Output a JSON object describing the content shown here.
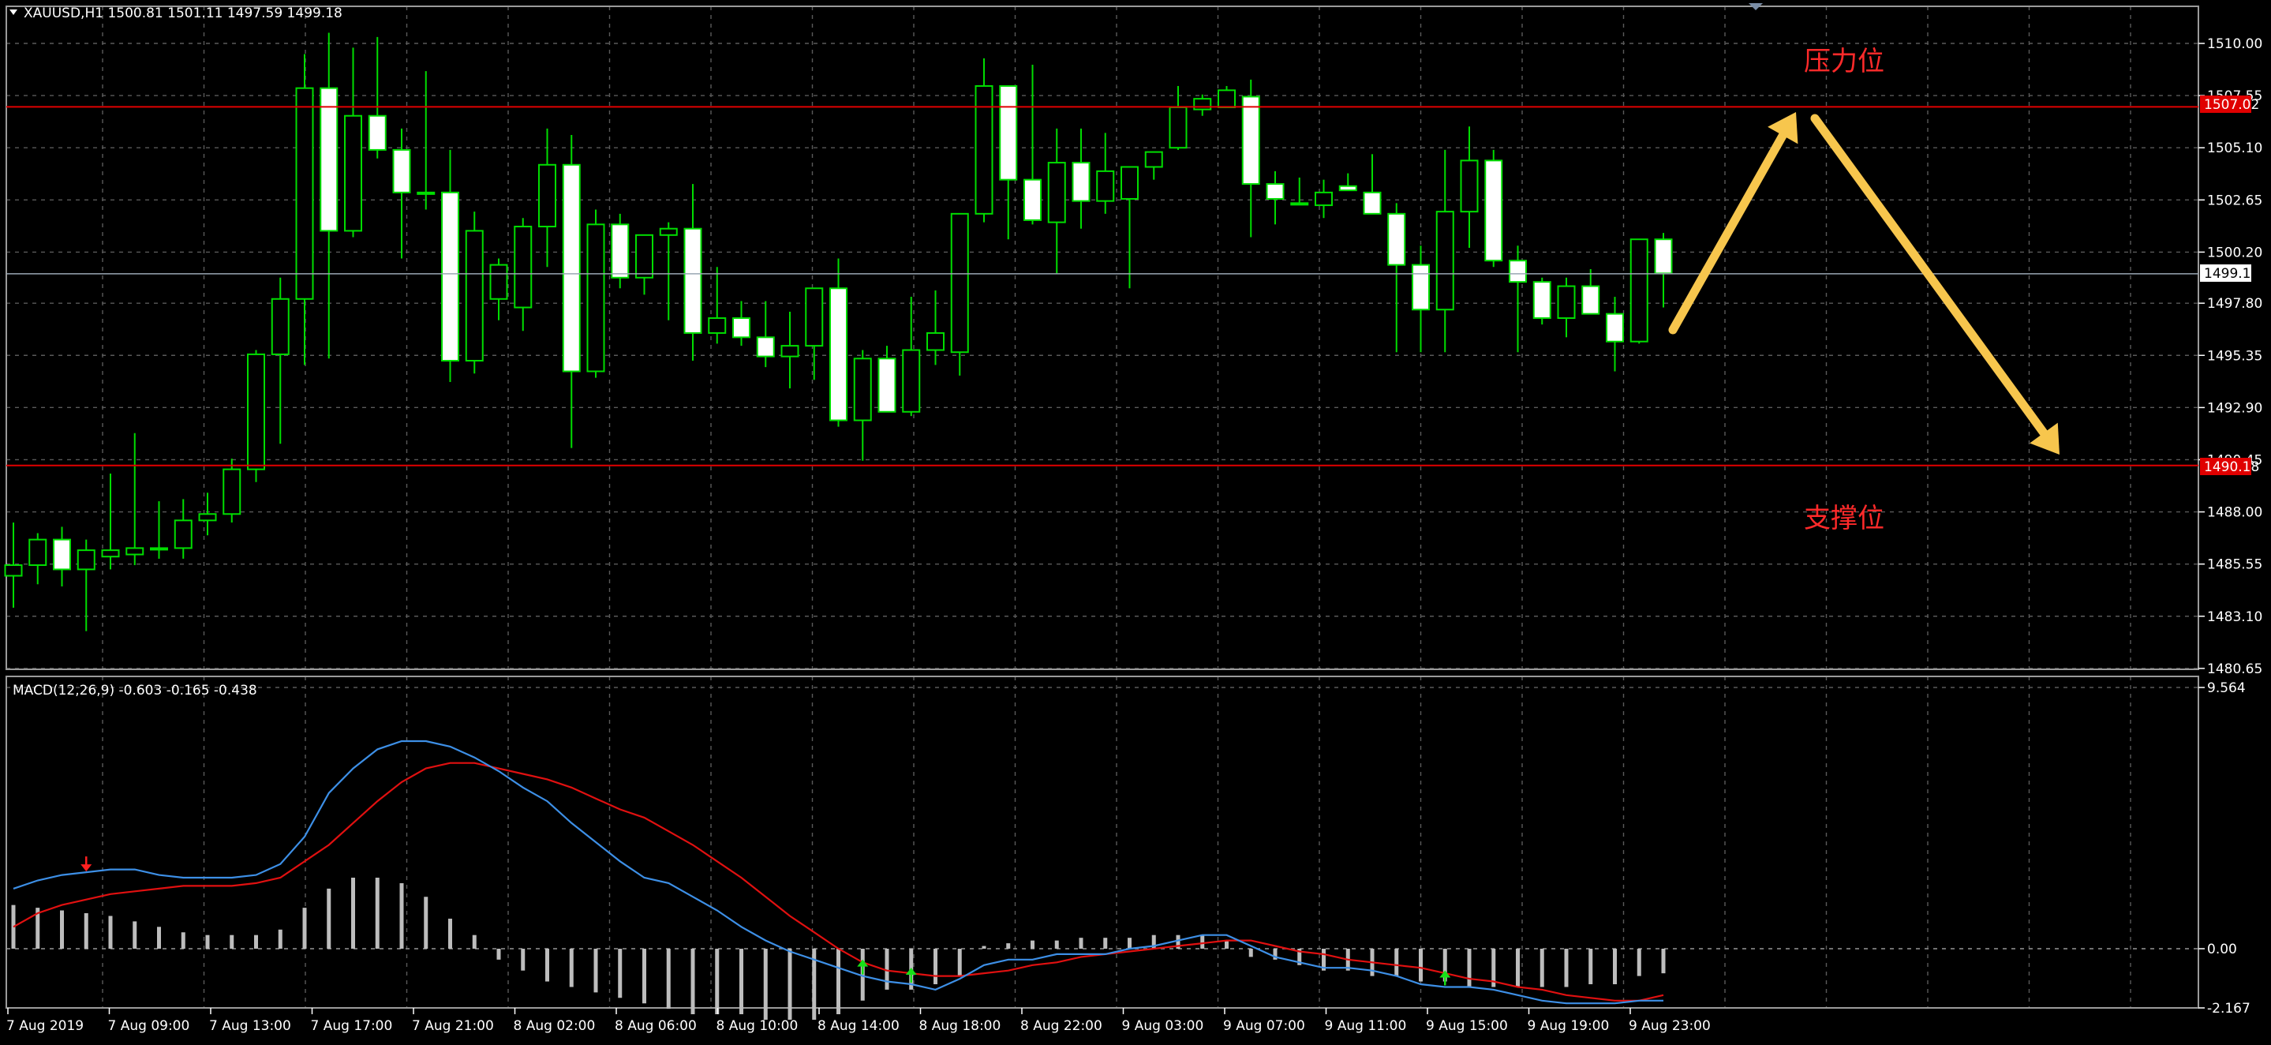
{
  "header": {
    "symbol_info": "XAUUSD,H1  1500.81 1501.11 1497.59 1499.18",
    "macd_info": "MACD(12,26,9) -0.603 -0.165 -0.438"
  },
  "annotations": {
    "resistance_label": "压力位",
    "support_label": "支撑位",
    "resistance_price": "1507.02",
    "support_price": "1490.18",
    "current_price": "1499.18"
  },
  "colors": {
    "background": "#000000",
    "grid": "#5a5a5a",
    "candle_up": "#000000",
    "candle_down": "#ffffff",
    "wick": "#00dd00",
    "level_line": "#e00000",
    "annotation_text": "#ff2a2a",
    "arrow": "#f7c64d",
    "macd_line": "#3d8fe6",
    "signal_line": "#e01010",
    "histogram": "#bdbdbd",
    "signal_arrow_up": "#18e018",
    "signal_arrow_down": "#ff2020",
    "axis_text": "#ffffff"
  },
  "chart_data": [
    {
      "type": "candlestick",
      "title": "XAUUSD,H1",
      "ylim": [
        1480.65,
        1510.9
      ],
      "y_ticks": [
        "1510.00",
        "1507.55",
        "1505.10",
        "1502.65",
        "1500.20",
        "1497.80",
        "1495.35",
        "1492.90",
        "1490.45",
        "1488.00",
        "1485.55",
        "1483.10",
        "1480.65"
      ],
      "x_tick_labels": [
        "7 Aug 2019",
        "7 Aug 09:00",
        "7 Aug 13:00",
        "7 Aug 17:00",
        "7 Aug 21:00",
        "8 Aug 02:00",
        "8 Aug 06:00",
        "8 Aug 10:00",
        "8 Aug 14:00",
        "8 Aug 18:00",
        "8 Aug 22:00",
        "9 Aug 03:00",
        "9 Aug 07:00",
        "9 Aug 11:00",
        "9 Aug 15:00",
        "9 Aug 19:00",
        "9 Aug 23:00"
      ],
      "horizontal_levels": [
        1507.02,
        1490.18
      ],
      "current_price": 1499.18,
      "ohlc": [
        [
          1485.0,
          1487.5,
          1483.5,
          1485.5
        ],
        [
          1485.5,
          1487.0,
          1484.6,
          1486.7
        ],
        [
          1486.7,
          1487.3,
          1484.5,
          1485.3
        ],
        [
          1485.3,
          1486.7,
          1482.4,
          1486.2
        ],
        [
          1485.9,
          1489.8,
          1485.3,
          1486.2
        ],
        [
          1486.0,
          1491.7,
          1485.5,
          1486.3
        ],
        [
          1486.3,
          1488.5,
          1485.8,
          1486.3
        ],
        [
          1486.3,
          1488.6,
          1485.8,
          1487.6
        ],
        [
          1487.6,
          1488.9,
          1486.9,
          1487.9
        ],
        [
          1487.9,
          1490.5,
          1487.5,
          1490.0
        ],
        [
          1490.0,
          1495.6,
          1489.4,
          1495.4
        ],
        [
          1495.4,
          1499.0,
          1491.2,
          1498.0
        ],
        [
          1498.0,
          1509.5,
          1494.9,
          1507.9
        ],
        [
          1507.9,
          1510.5,
          1495.2,
          1501.2
        ],
        [
          1501.2,
          1509.8,
          1500.9,
          1506.6
        ],
        [
          1506.6,
          1510.3,
          1504.6,
          1505.0
        ],
        [
          1505.0,
          1506.0,
          1499.9,
          1503.0
        ],
        [
          1503.0,
          1508.7,
          1502.2,
          1503.0
        ],
        [
          1503.0,
          1505.0,
          1494.1,
          1495.1
        ],
        [
          1495.1,
          1502.1,
          1494.5,
          1501.2
        ],
        [
          1498.0,
          1499.9,
          1497.0,
          1499.6
        ],
        [
          1497.6,
          1501.8,
          1496.5,
          1501.4
        ],
        [
          1501.4,
          1506.0,
          1499.5,
          1504.3
        ],
        [
          1504.3,
          1505.7,
          1491.0,
          1494.6
        ],
        [
          1494.6,
          1502.2,
          1494.3,
          1501.5
        ],
        [
          1501.5,
          1502.0,
          1498.5,
          1499.0
        ],
        [
          1499.0,
          1501.0,
          1498.2,
          1501.0
        ],
        [
          1501.0,
          1501.6,
          1497.0,
          1501.3
        ],
        [
          1501.3,
          1503.4,
          1495.1,
          1496.4
        ],
        [
          1496.4,
          1499.5,
          1495.9,
          1497.1
        ],
        [
          1497.1,
          1497.9,
          1495.8,
          1496.2
        ],
        [
          1496.2,
          1497.9,
          1494.8,
          1495.3
        ],
        [
          1495.3,
          1497.4,
          1493.8,
          1495.8
        ],
        [
          1495.8,
          1498.4,
          1494.2,
          1498.5
        ],
        [
          1498.5,
          1499.9,
          1492.0,
          1492.3
        ],
        [
          1492.3,
          1495.6,
          1490.4,
          1495.2
        ],
        [
          1495.2,
          1495.8,
          1492.8,
          1492.7
        ],
        [
          1492.7,
          1498.1,
          1492.5,
          1495.6
        ],
        [
          1495.6,
          1498.4,
          1494.9,
          1496.4
        ],
        [
          1495.5,
          1502.0,
          1494.4,
          1502.0
        ],
        [
          1502.0,
          1509.3,
          1501.6,
          1508.0
        ],
        [
          1508.0,
          1508.0,
          1500.8,
          1503.6
        ],
        [
          1503.6,
          1509.0,
          1501.5,
          1501.7
        ],
        [
          1501.6,
          1506.0,
          1499.2,
          1504.4
        ],
        [
          1504.4,
          1506.0,
          1501.3,
          1502.6
        ],
        [
          1502.6,
          1505.8,
          1502.0,
          1504.0
        ],
        [
          1502.7,
          1504.2,
          1498.5,
          1504.2
        ],
        [
          1504.2,
          1504.9,
          1503.6,
          1504.9
        ],
        [
          1505.1,
          1508.0,
          1505.0,
          1507.0
        ],
        [
          1506.9,
          1507.6,
          1506.6,
          1507.4
        ],
        [
          1507.0,
          1508.0,
          1507.0,
          1507.8
        ],
        [
          1507.5,
          1508.3,
          1500.9,
          1503.4
        ],
        [
          1503.4,
          1504.0,
          1501.5,
          1502.7
        ],
        [
          1502.5,
          1503.7,
          1502.5,
          1502.5
        ],
        [
          1502.4,
          1503.6,
          1501.8,
          1503.0
        ],
        [
          1503.3,
          1503.9,
          1503.2,
          1503.1
        ],
        [
          1503.0,
          1504.8,
          1502.0,
          1502.0
        ],
        [
          1502.0,
          1502.5,
          1495.5,
          1499.6
        ],
        [
          1499.6,
          1500.5,
          1495.5,
          1497.5
        ],
        [
          1497.5,
          1505.0,
          1495.5,
          1502.1
        ],
        [
          1502.1,
          1506.1,
          1500.4,
          1504.5
        ],
        [
          1504.5,
          1505.0,
          1499.5,
          1499.8
        ],
        [
          1499.8,
          1500.5,
          1495.5,
          1498.8
        ],
        [
          1498.8,
          1499.0,
          1496.8,
          1497.1
        ],
        [
          1497.1,
          1499.0,
          1496.2,
          1498.6
        ],
        [
          1498.6,
          1499.4,
          1497.4,
          1497.3
        ],
        [
          1497.3,
          1498.1,
          1494.6,
          1496.0
        ],
        [
          1496.0,
          1500.8,
          1495.9,
          1500.8
        ],
        [
          1500.8,
          1501.1,
          1497.6,
          1499.2
        ]
      ]
    },
    {
      "type": "line",
      "title": "MACD(12,26,9) -0.603 -0.165 -0.438",
      "ylim": [
        -2.167,
        9.564
      ],
      "y_ticks": [
        "9.564",
        "0.00",
        "-2.167"
      ],
      "series": [
        {
          "name": "MACD",
          "values": [
            2.2,
            2.5,
            2.7,
            2.8,
            2.9,
            2.9,
            2.7,
            2.6,
            2.6,
            2.6,
            2.7,
            3.1,
            4.1,
            5.7,
            6.6,
            7.3,
            7.6,
            7.6,
            7.4,
            7.0,
            6.5,
            5.9,
            5.4,
            4.6,
            3.9,
            3.2,
            2.6,
            2.4,
            1.9,
            1.4,
            0.8,
            0.3,
            -0.1,
            -0.4,
            -0.7,
            -1.0,
            -1.2,
            -1.3,
            -1.5,
            -1.1,
            -0.6,
            -0.4,
            -0.4,
            -0.2,
            -0.2,
            -0.2,
            0.0,
            0.1,
            0.3,
            0.5,
            0.5,
            0.1,
            -0.3,
            -0.5,
            -0.7,
            -0.7,
            -0.8,
            -1.0,
            -1.3,
            -1.4,
            -1.4,
            -1.5,
            -1.7,
            -1.9,
            -2.0,
            -2.0,
            -2.0,
            -1.9,
            -1.9
          ]
        },
        {
          "name": "Signal",
          "values": [
            0.8,
            1.3,
            1.6,
            1.8,
            2.0,
            2.1,
            2.2,
            2.3,
            2.3,
            2.3,
            2.4,
            2.6,
            3.2,
            3.8,
            4.6,
            5.4,
            6.1,
            6.6,
            6.8,
            6.8,
            6.6,
            6.4,
            6.2,
            5.9,
            5.5,
            5.1,
            4.8,
            4.3,
            3.8,
            3.2,
            2.6,
            1.9,
            1.2,
            0.6,
            0.0,
            -0.5,
            -0.8,
            -0.9,
            -1.0,
            -1.0,
            -0.9,
            -0.8,
            -0.6,
            -0.5,
            -0.3,
            -0.2,
            -0.1,
            0.0,
            0.1,
            0.2,
            0.3,
            0.3,
            0.1,
            -0.1,
            -0.2,
            -0.4,
            -0.5,
            -0.6,
            -0.7,
            -0.9,
            -1.1,
            -1.2,
            -1.4,
            -1.5,
            -1.7,
            -1.8,
            -1.9,
            -1.9,
            -1.7
          ]
        }
      ],
      "histogram": [
        1.6,
        1.5,
        1.4,
        1.3,
        1.2,
        1.0,
        0.8,
        0.6,
        0.5,
        0.5,
        0.5,
        0.7,
        1.5,
        2.2,
        2.6,
        2.6,
        2.4,
        1.9,
        1.1,
        0.5,
        -0.4,
        -0.8,
        -1.2,
        -1.4,
        -1.6,
        -1.8,
        -2.0,
        -2.2,
        -2.4,
        -2.4,
        -2.4,
        -2.6,
        -2.6,
        -2.6,
        -2.4,
        -1.9,
        -1.5,
        -1.5,
        -1.3,
        -1.0,
        0.1,
        0.2,
        0.3,
        0.3,
        0.4,
        0.4,
        0.4,
        0.5,
        0.5,
        0.5,
        0.3,
        -0.3,
        -0.4,
        -0.6,
        -0.8,
        -0.8,
        -1.0,
        -1.0,
        -1.2,
        -1.2,
        -1.4,
        -1.4,
        -1.4,
        -1.4,
        -1.4,
        -1.3,
        -1.3,
        -1.0,
        -0.9
      ],
      "signal_arrows": [
        {
          "index": 3,
          "dir": "down"
        },
        {
          "index": 35,
          "dir": "up"
        },
        {
          "index": 37,
          "dir": "up"
        },
        {
          "index": 59,
          "dir": "up"
        }
      ]
    }
  ]
}
